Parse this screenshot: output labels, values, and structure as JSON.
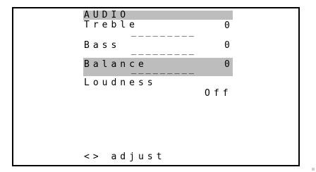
{
  "menu": {
    "title": "AUDIO",
    "items": [
      {
        "label": "Treble",
        "value": "0",
        "bar": "_________"
      },
      {
        "label": "Bass",
        "value": "0",
        "bar": "_________"
      },
      {
        "label": "Balance",
        "value": "0",
        "bar": "_________"
      },
      {
        "label": "Loudness",
        "value": "Off"
      }
    ],
    "hint": "<> adjust"
  },
  "colors": {
    "background": "#ffffff",
    "text": "#000000",
    "highlight": "#bdbdbd"
  }
}
